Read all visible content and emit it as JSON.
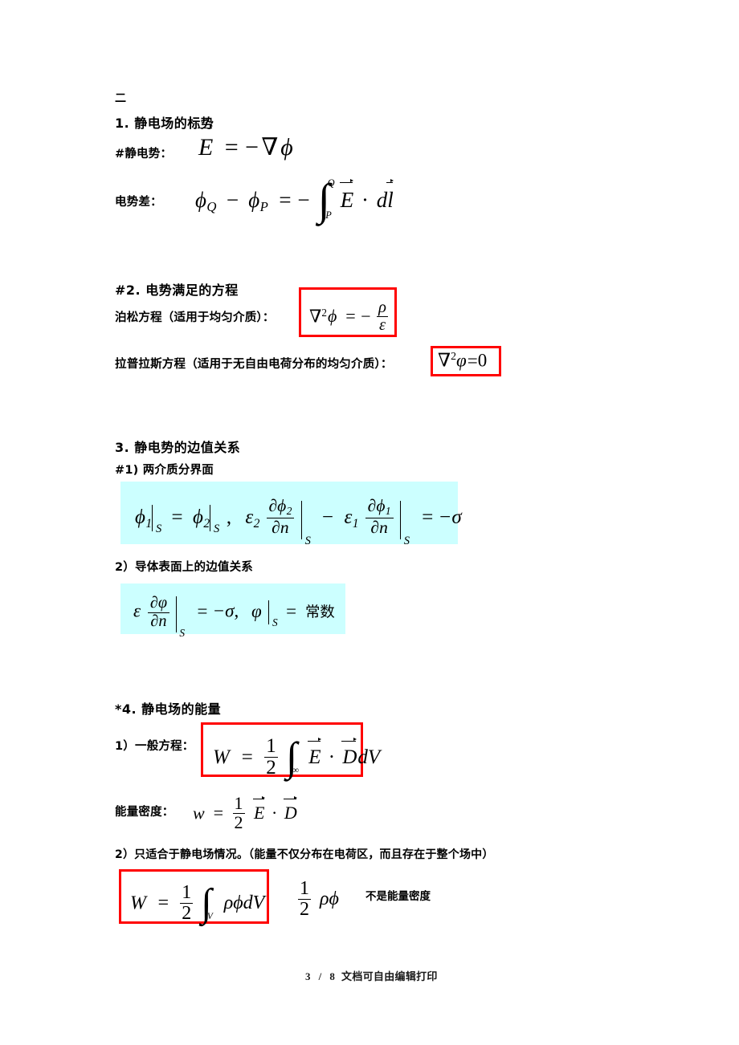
{
  "document": {
    "section_marker": "二",
    "footer": {
      "page_current": "3",
      "separator": "/",
      "page_total": "8",
      "note": "文档可自由编辑打印"
    }
  },
  "sections": {
    "s1": {
      "heading": "1.  静电场的标势",
      "line1_label": "#静电势：",
      "line1_formula": "E⃗ = −∇φ",
      "line2_label": "电势差：",
      "line2_formula": "φ_Q − φ_P = −∫_P^Q E⃗·dl⃗"
    },
    "s2": {
      "heading": "#2. 电势满足的方程",
      "poisson_label": "泊松方程（适用于均匀介质）：",
      "poisson_formula": "∇²φ = −ρ/ε",
      "laplace_label": "拉普拉斯方程（适用于无自由电荷分布的均匀介质）：",
      "laplace_formula": "∇²φ=0"
    },
    "s3": {
      "heading": "3.  静电势的边值关系",
      "sub1_label": "#1)  两介质分界面",
      "sub1_formula": "φ₁|_S = φ₂|_S ,  ε₂ ∂φ₂/∂n |_S − ε₁ ∂φ₁/∂n |_S = −σ",
      "sub2_label": "2）导体表面上的边值关系",
      "sub2_formula": "ε ∂φ/∂n |_S = −σ,  φ|_S = 常数",
      "sub2_constant_word": "常数"
    },
    "s4": {
      "heading": "*4. 静电场的能量",
      "sub1_label": "1）一般方程：",
      "sub1_formula": "W = ½ ∫_∞ E⃗·D⃗ dV",
      "density_label": "能量密度：",
      "density_formula": "w = ½ E⃗·D⃗",
      "sub2_label": "2）只适合于静电场情况。（能量不仅分布在电荷区，而且存在于整个场中）",
      "sub2_formula": "W = ½ ∫_V ρφ dV",
      "sub2_note_formula": "½ ρφ",
      "sub2_note_text": "不是能量密度"
    }
  },
  "symbols": {
    "one": "1",
    "two": "2",
    "zero": "0",
    "nabla": "∇",
    "nabla_sq_exp": "2",
    "phi": "φ",
    "varphi": "φ",
    "rho": "ρ",
    "epsilon": "ε",
    "sigma": "σ",
    "partial": "∂",
    "n": "n",
    "S": "S",
    "V": "V",
    "P": "P",
    "Q": "Q",
    "E": "E",
    "D": "D",
    "W": "W",
    "w": "w",
    "d": "d",
    "l": "l",
    "dV": "dV",
    "equals": "=",
    "minus": "−",
    "dot": "·",
    "comma": "，",
    "infinity": "∞",
    "integral": "∫"
  },
  "colors": {
    "red_outline": "#ff0000",
    "cyan_highlight": "#ccffff",
    "text": "#000000",
    "page_background": "#ffffff"
  }
}
